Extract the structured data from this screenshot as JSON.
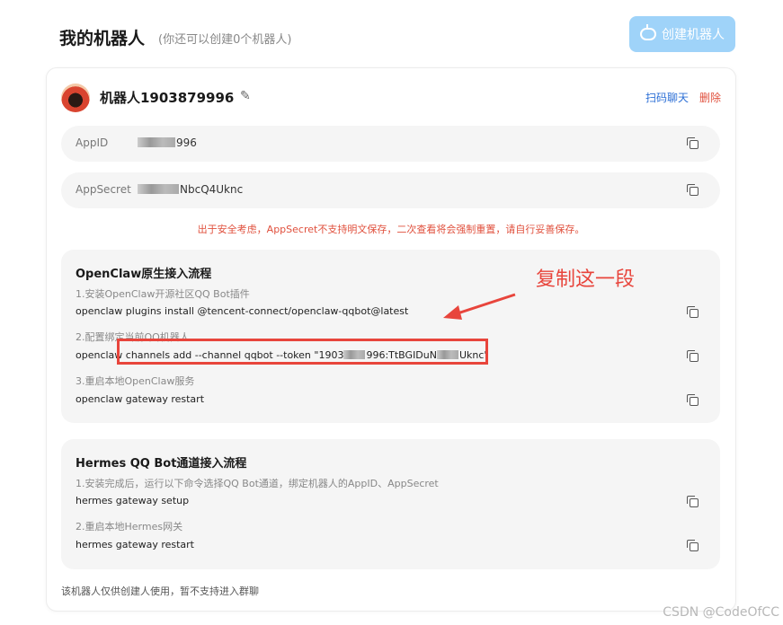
{
  "header": {
    "title": "我的机器人",
    "quota_note": "(你还可以创建0个机器人)",
    "create_button": "创建机器人"
  },
  "bot": {
    "name": "机器人1903879996",
    "scan_chat": "扫码聊天",
    "delete": "删除"
  },
  "fields": {
    "appid_label": "AppID",
    "appid_value_visible": "996",
    "appsecret_label": "AppSecret",
    "appsecret_value_visible": "NbcQ4Uknc"
  },
  "warning": "出于安全考虑，AppSecret不支持明文保存，二次查看将会强制重置，请自行妥善保存。",
  "openclaw": {
    "title": "OpenClaw原生接入流程",
    "step1": "1.安装OpenClaw开源社区QQ Bot插件",
    "cmd1": "openclaw plugins install @tencent-connect/openclaw-qqbot@latest",
    "step2": "2.配置绑定当前QQ机器人",
    "cmd2_prefix": "openclaw channels add --channel qqbot --token \"1903",
    "cmd2_mid": "996:TtBGIDuN",
    "cmd2_suffix": "Uknc\"",
    "step3": "3.重启本地OpenClaw服务",
    "cmd3": "openclaw gateway restart"
  },
  "hermes": {
    "title": "Hermes QQ Bot通道接入流程",
    "step1": "1.安装完成后，运行以下命令选择QQ Bot通道，绑定机器人的AppID、AppSecret",
    "cmd1": "hermes gateway setup",
    "step2": "2.重启本地Hermes网关",
    "cmd2": "hermes gateway restart"
  },
  "footer_note": "该机器人仅供创建人使用，暂不支持进入群聊",
  "annotation": {
    "callout": "复制这一段"
  },
  "watermark": "CSDN @CodeOfCC",
  "colors": {
    "accent_blue": "#9fd3f9",
    "link_blue": "#2c6fd6",
    "danger_red": "#e0503d",
    "annotation_red": "#e8453c"
  },
  "icons": {
    "create": "robot-icon",
    "edit": "pencil-icon",
    "copy": "copy-icon"
  }
}
